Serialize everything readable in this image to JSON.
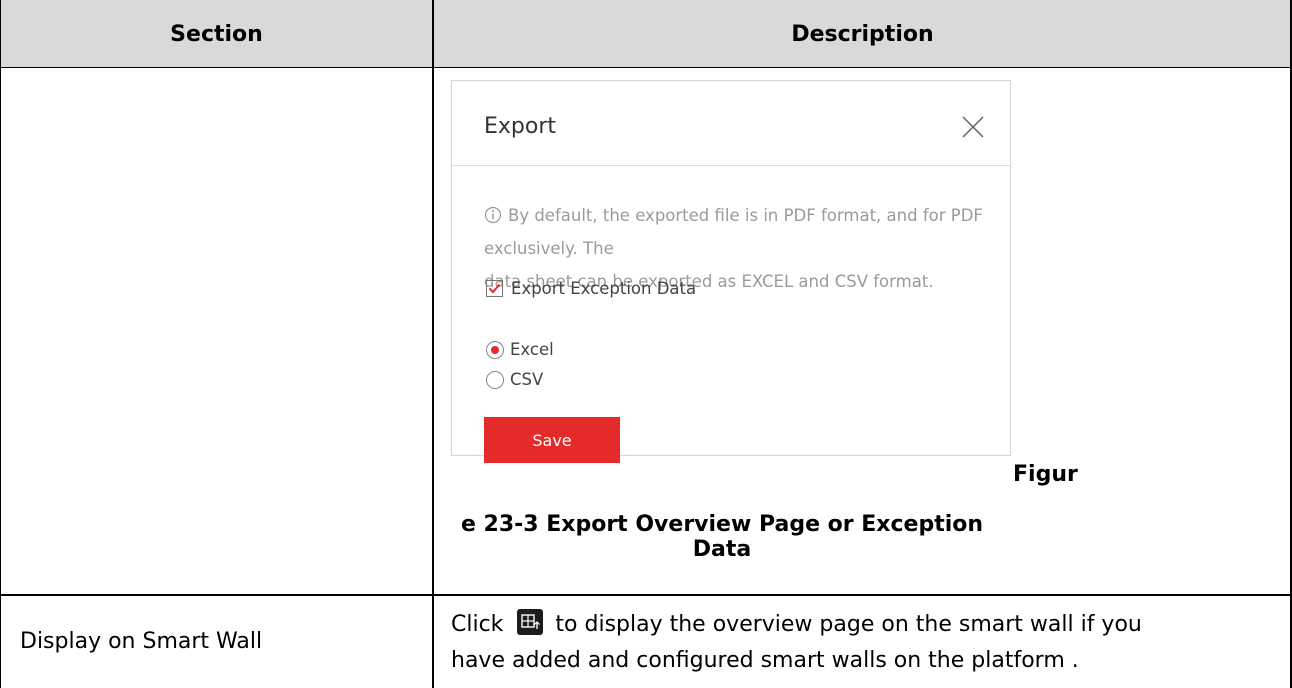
{
  "table": {
    "headers": {
      "section": "Section",
      "description": "Description"
    }
  },
  "dialog": {
    "title": "Export",
    "info_line1": "By default, the exported file is in PDF format, and for PDF exclusively. The",
    "info_line2": "data sheet can be exported as EXCEL and CSV format.",
    "checkbox_label": "Export Exception Data",
    "checkbox_checked": true,
    "radio_excel_label": "Excel",
    "radio_csv_label": "CSV",
    "selected_format": "Excel",
    "save_label": "Save",
    "accent_color": "#e52a2a"
  },
  "caption": {
    "part1": "Figur",
    "part2": "e 23-3 Export Overview Page or Exception Data"
  },
  "rows": {
    "smart_wall": {
      "section": "Display on Smart Wall",
      "desc_prefix": "Click",
      "desc_line1_rest": "to display the overview page on the smart wall if you",
      "desc_line2": "have added and configured smart walls on the platform .",
      "icon": "smart-wall-icon"
    }
  }
}
